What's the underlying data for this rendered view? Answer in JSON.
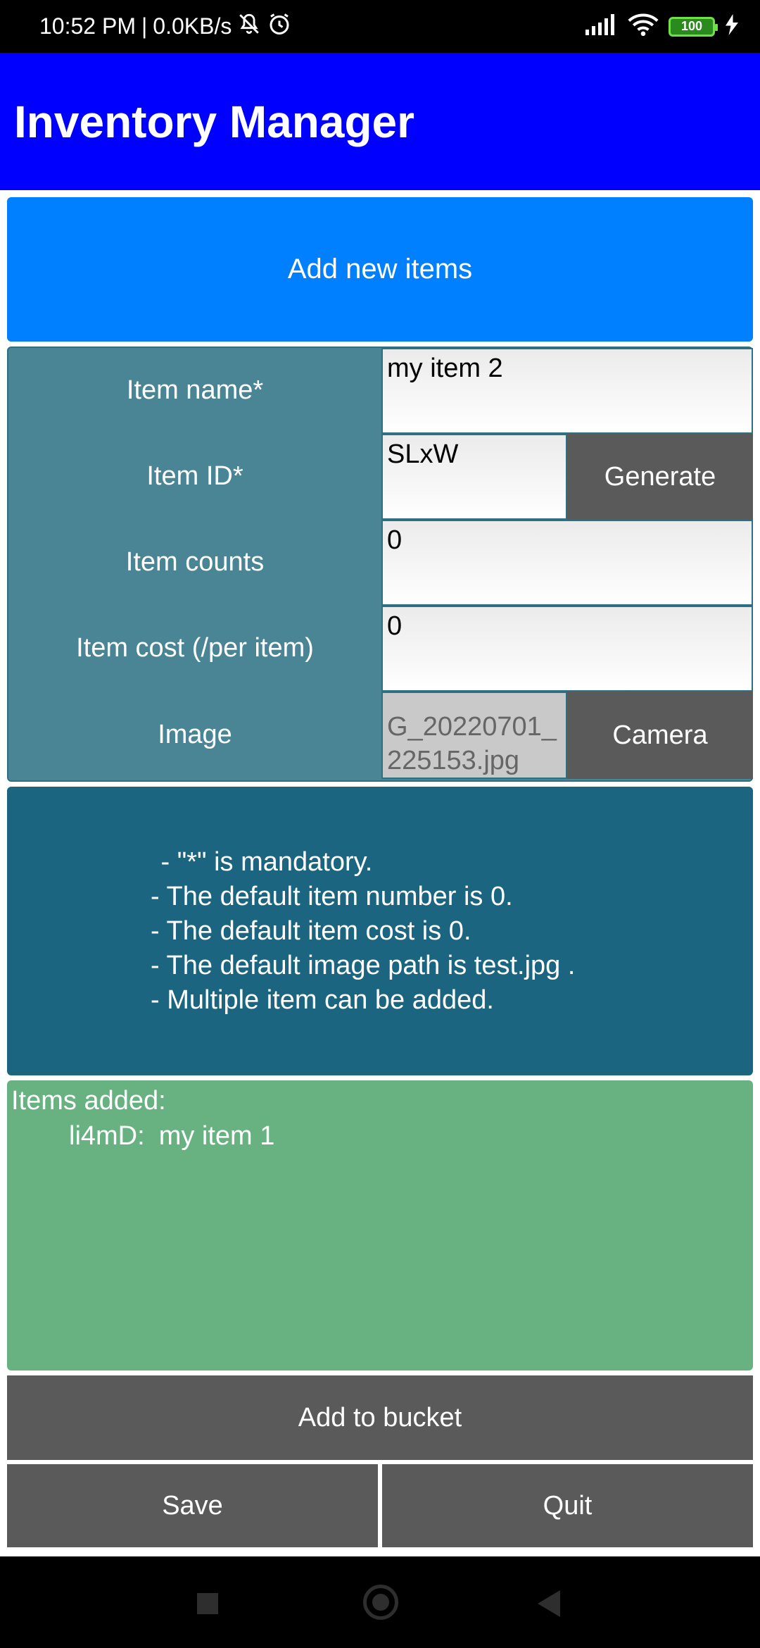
{
  "status": {
    "time": "10:52 PM",
    "net_speed": "0.0KB/s",
    "battery": "100"
  },
  "appbar": {
    "title": "Inventory Manager"
  },
  "add_new": {
    "label": "Add new items"
  },
  "form": {
    "item_name": {
      "label": "Item name*",
      "value": "my item 2"
    },
    "item_id": {
      "label": "Item ID*",
      "value": "SLxW",
      "button": "Generate"
    },
    "item_counts": {
      "label": "Item counts",
      "value": "0"
    },
    "item_cost": {
      "label": "Item cost (/per item)",
      "value": "0"
    },
    "image": {
      "label": "Image",
      "path_lines": [
        "G_20220701_",
        "225153.jpg"
      ],
      "button": "Camera"
    }
  },
  "notes": [
    " - \"*\" is mandatory.",
    "- The default item number is 0.",
    "- The default item cost is 0.",
    "- The default image path is test.jpg .",
    "- Multiple item can be added."
  ],
  "added": {
    "title": "Items added:",
    "items": [
      {
        "id": "li4mD:",
        "name": "my item 1"
      }
    ]
  },
  "buttons": {
    "add_to_bucket": "Add to bucket",
    "save": "Save",
    "quit": "Quit"
  }
}
